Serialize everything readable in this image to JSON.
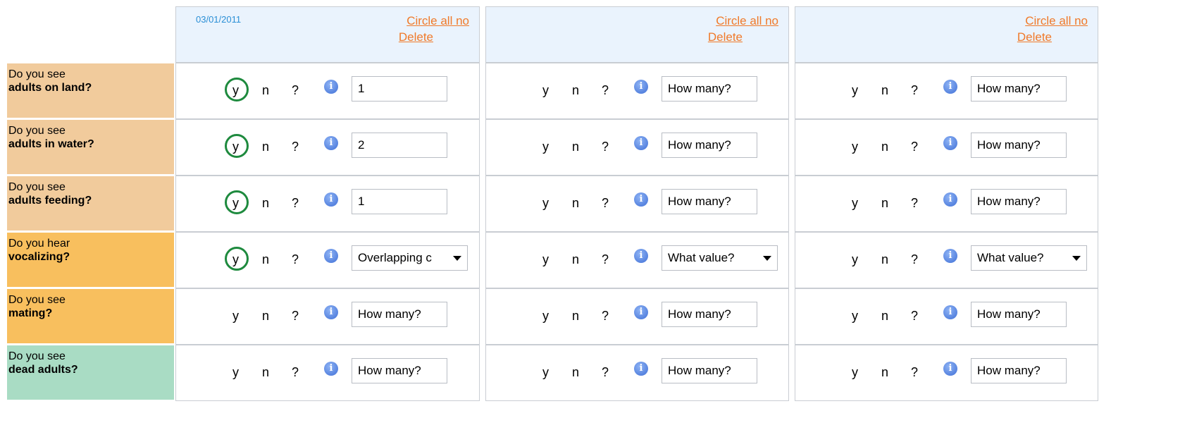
{
  "columns": [
    {
      "date": "03/01/2011",
      "circle_all_no": "Circle all no",
      "delete": "Delete"
    },
    {
      "date": "",
      "circle_all_no": "Circle all no",
      "delete": "Delete"
    },
    {
      "date": "",
      "circle_all_no": "Circle all no",
      "delete": "Delete"
    }
  ],
  "rows": [
    {
      "line1": "Do you see",
      "line2": "adults on land?",
      "color": "#f1cb9c"
    },
    {
      "line1": "Do you see",
      "line2": "adults in water?",
      "color": "#f1cb9c"
    },
    {
      "line1": "Do you see",
      "line2": "adults feeding?",
      "color": "#f1cb9c"
    },
    {
      "line1": "Do you hear",
      "line2": "vocalizing?",
      "color": "#f8bf5e"
    },
    {
      "line1": "Do you see",
      "line2": "mating?",
      "color": "#f8bf5e"
    },
    {
      "line1": "Do you see",
      "line2": "dead adults?",
      "color": "#a9dcc4"
    }
  ],
  "options": {
    "yes": "y",
    "no": "n",
    "unknown": "?"
  },
  "info_icon": "i",
  "placeholders": {
    "count": "How many?",
    "value": "What value?"
  },
  "cells": [
    [
      {
        "selected": "y",
        "value": "1"
      },
      {
        "selected": "",
        "value": ""
      },
      {
        "selected": "",
        "value": ""
      }
    ],
    [
      {
        "selected": "y",
        "value": "2"
      },
      {
        "selected": "",
        "value": ""
      },
      {
        "selected": "",
        "value": ""
      }
    ],
    [
      {
        "selected": "y",
        "value": "1"
      },
      {
        "selected": "",
        "value": ""
      },
      {
        "selected": "",
        "value": ""
      }
    ],
    [
      {
        "selected": "y",
        "value": "Overlapping c"
      },
      {
        "selected": "",
        "value": "What value?"
      },
      {
        "selected": "",
        "value": "What value?"
      }
    ],
    [
      {
        "selected": "",
        "value": ""
      },
      {
        "selected": "",
        "value": ""
      },
      {
        "selected": "",
        "value": ""
      }
    ],
    [
      {
        "selected": "",
        "value": ""
      },
      {
        "selected": "",
        "value": ""
      },
      {
        "selected": "",
        "value": ""
      }
    ]
  ],
  "accent_colors": {
    "selected_circle": "#1e8a3e",
    "link": "#f07a2a",
    "date": "#2a8fd6",
    "header_bg": "#eaf3fd"
  }
}
